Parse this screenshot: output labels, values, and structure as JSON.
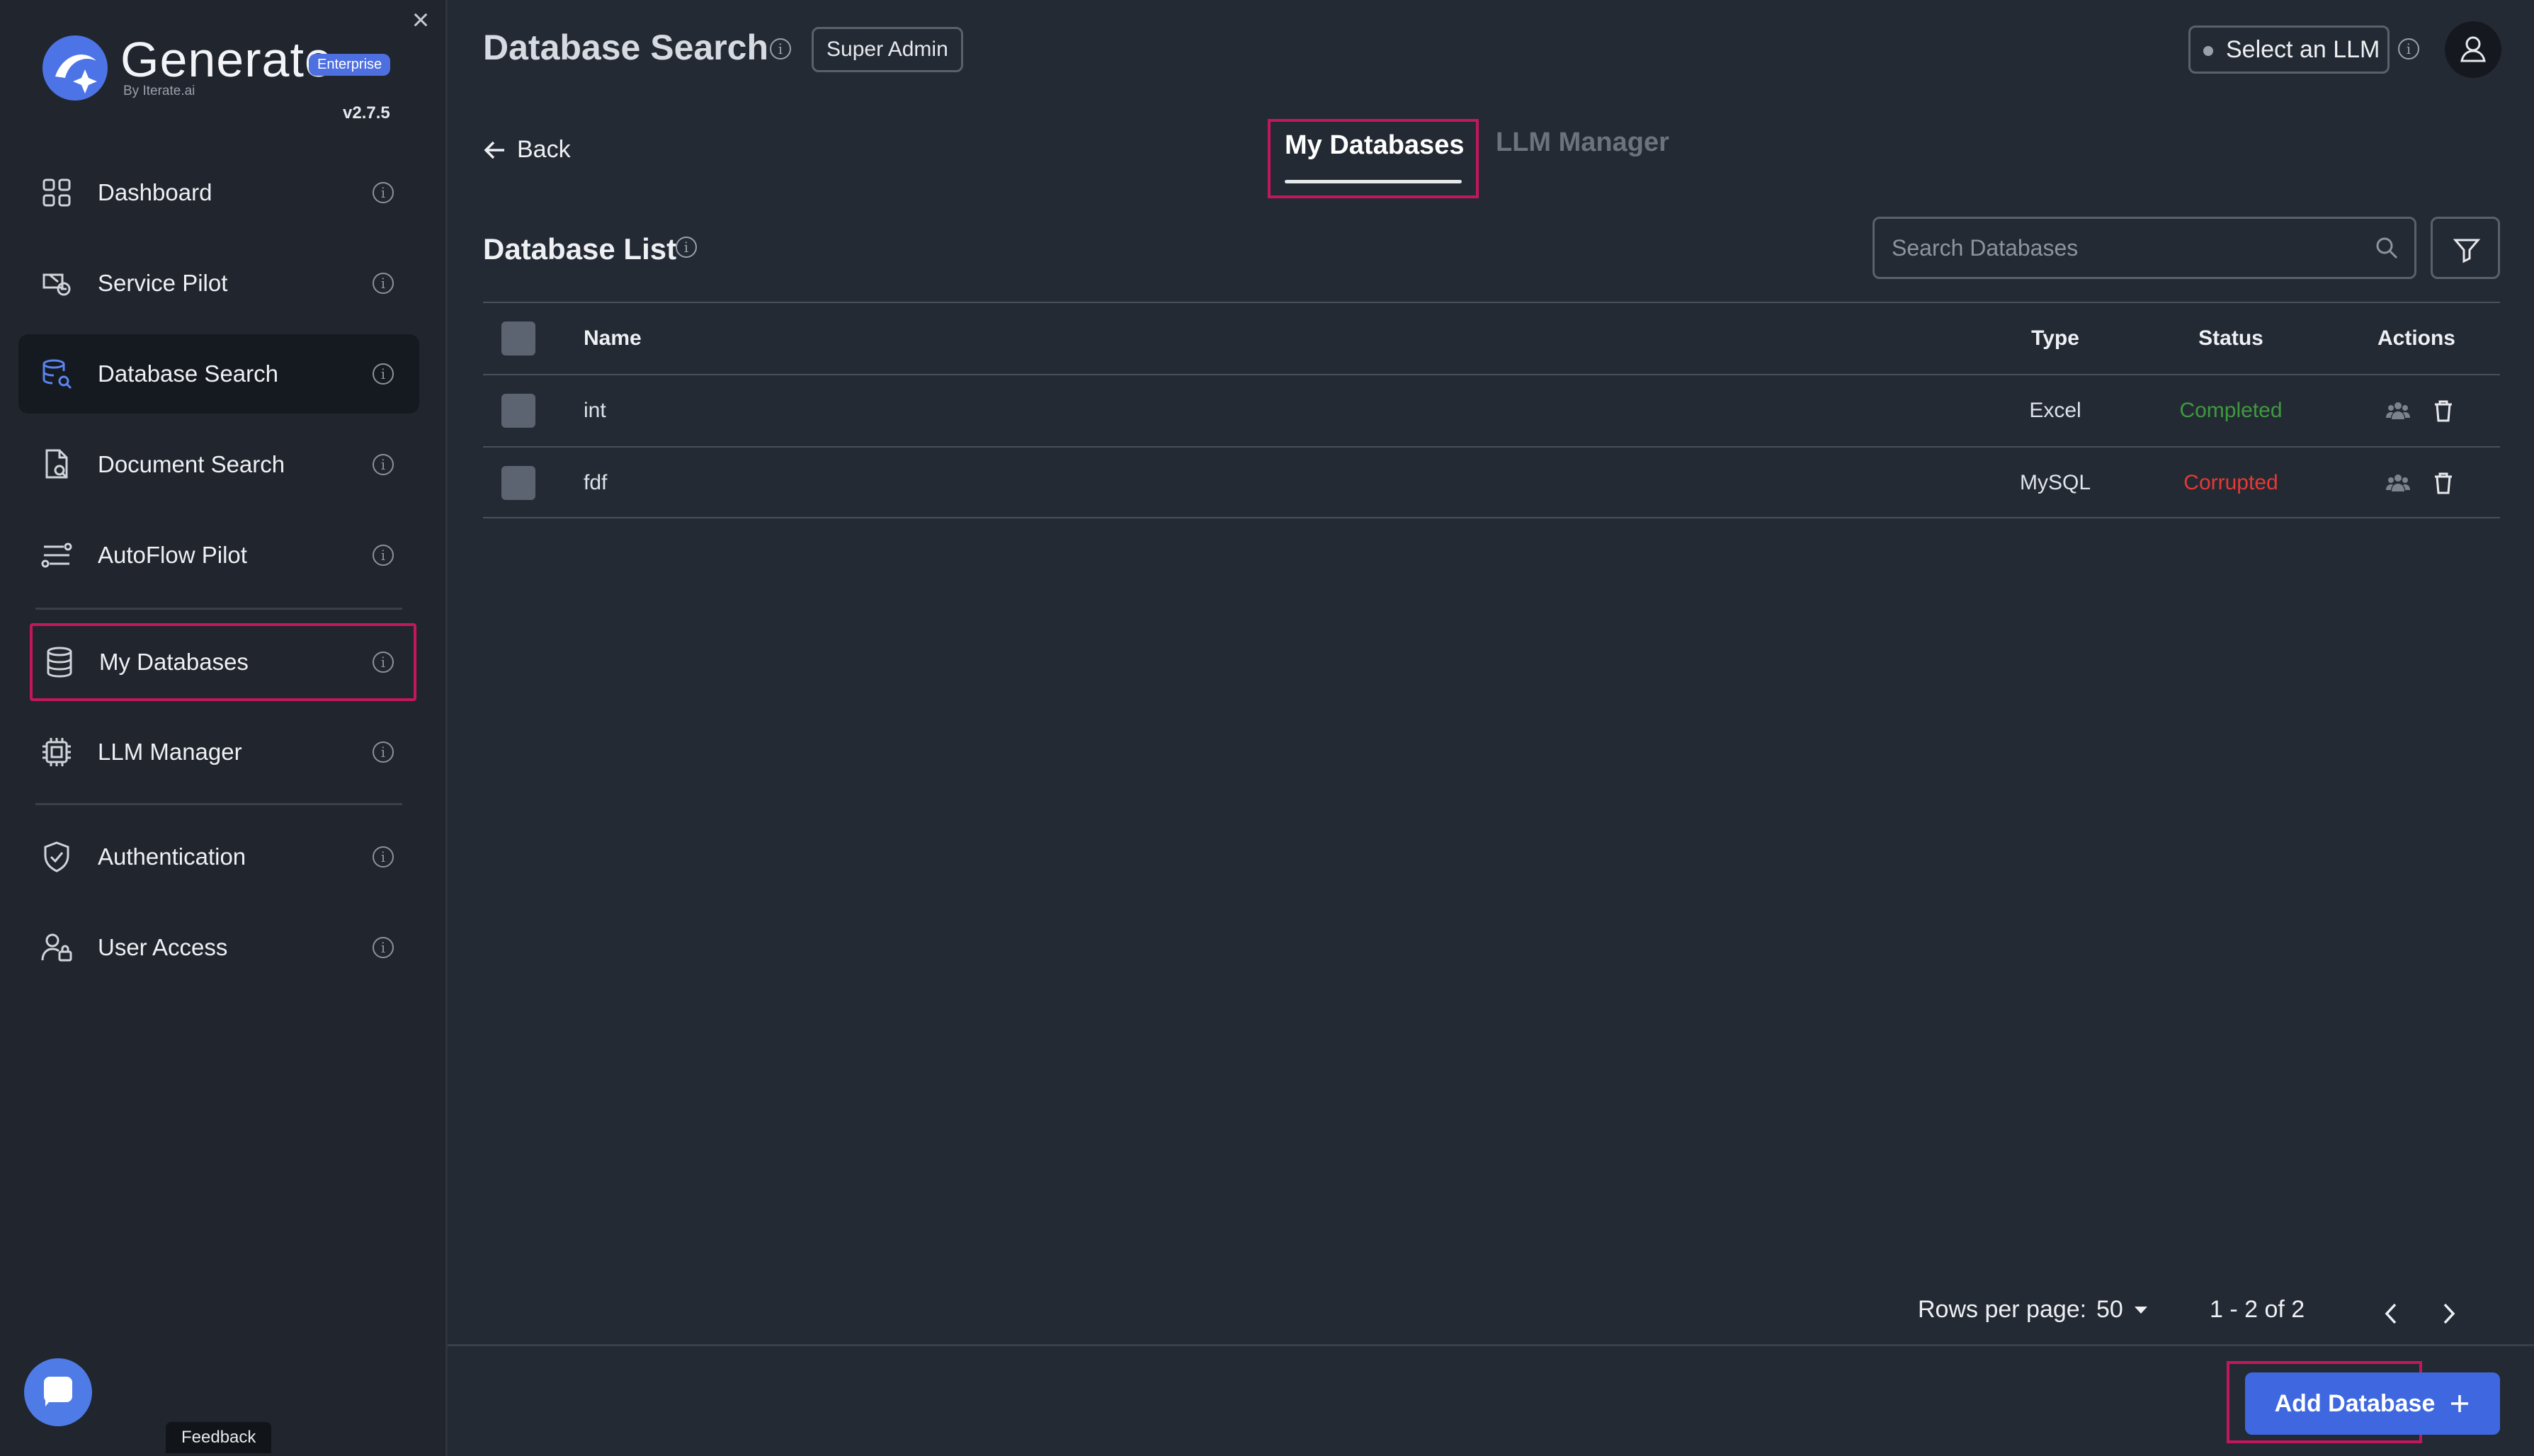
{
  "sidebar": {
    "brand": "Generate",
    "edition": "Enterprise",
    "by_line": "By Iterate.ai",
    "version": "v2.7.5",
    "items": [
      {
        "label": "Dashboard",
        "icon": "grid-icon"
      },
      {
        "label": "Service Pilot",
        "icon": "service-pilot-icon"
      },
      {
        "label": "Database Search",
        "icon": "database-search-icon",
        "active": true
      },
      {
        "label": "Document Search",
        "icon": "document-search-icon"
      },
      {
        "label": "AutoFlow Pilot",
        "icon": "autoflow-icon"
      },
      {
        "label": "My Databases",
        "icon": "database-icon",
        "highlighted": true
      },
      {
        "label": "LLM Manager",
        "icon": "chip-icon"
      },
      {
        "label": "Authentication",
        "icon": "shield-icon"
      },
      {
        "label": "User Access",
        "icon": "user-lock-icon"
      }
    ],
    "feedback": "Feedback"
  },
  "header": {
    "title": "Database Search",
    "role_badge": "Super Admin",
    "llm_select": "Select an LLM"
  },
  "nav": {
    "back": "Back",
    "tabs": [
      {
        "label": "My Databases",
        "active": true
      },
      {
        "label": "LLM Manager",
        "active": false
      }
    ]
  },
  "list": {
    "title": "Database List",
    "search_placeholder": "Search Databases",
    "columns": [
      "Name",
      "Type",
      "Status",
      "Actions"
    ],
    "rows": [
      {
        "name": "int",
        "type": "Excel",
        "status": "Completed"
      },
      {
        "name": "fdf",
        "type": "MySQL",
        "status": "Corrupted"
      }
    ]
  },
  "pagination": {
    "rows_per_page_label": "Rows per page:",
    "rows_per_page": "50",
    "range": "1 - 2 of 2"
  },
  "footer": {
    "add_button": "Add Database"
  },
  "colors": {
    "accent": "#3f68e0",
    "completed": "#3e9a3e",
    "corrupted": "#e53935",
    "highlight": "#c2185b"
  }
}
